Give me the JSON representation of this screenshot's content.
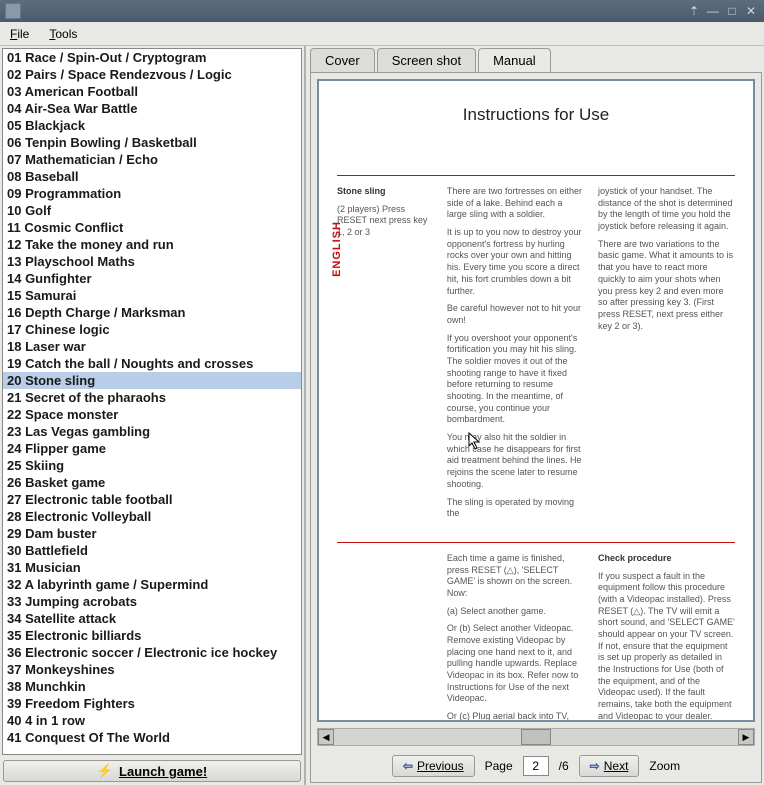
{
  "menu": {
    "file": "File",
    "tools": "Tools"
  },
  "titlebar": {
    "pin": "⇡",
    "min": "—",
    "max": "□",
    "close": "✕"
  },
  "games": {
    "selected_index": 19,
    "items": [
      "01 Race / Spin-Out / Cryptogram",
      "02 Pairs / Space Rendezvous / Logic",
      "03 American Football",
      "04 Air-Sea War Battle",
      "05 Blackjack",
      "06 Tenpin Bowling / Basketball",
      "07 Mathematician / Echo",
      "08 Baseball",
      "09 Programmation",
      "10 Golf",
      "11 Cosmic Conflict",
      "12 Take the money and run",
      "13 Playschool Maths",
      "14 Gunfighter",
      "15 Samurai",
      "16 Depth Charge / Marksman",
      "17 Chinese logic",
      "18 Laser war",
      "19 Catch the ball / Noughts and crosses",
      "20 Stone sling",
      "21 Secret of the pharaohs",
      "22 Space monster",
      "23 Las Vegas gambling",
      "24 Flipper game",
      "25 Skiing",
      "26 Basket game",
      "27 Electronic table football",
      "28 Electronic Volleyball",
      "29 Dam buster",
      "30 Battlefield",
      "31 Musician",
      "32 A labyrinth game / Supermind",
      "33 Jumping acrobats",
      "34 Satellite attack",
      "35 Electronic billiards",
      "36 Electronic soccer / Electronic ice hockey",
      "37 Monkeyshines",
      "38 Munchkin",
      "39 Freedom Fighters",
      "40 4 in 1 row",
      "41 Conquest Of The World"
    ]
  },
  "launch_label": "Launch game!",
  "tabs": {
    "cover": "Cover",
    "screenshot": "Screen shot",
    "manual": "Manual",
    "active": "manual"
  },
  "manual": {
    "title": "Instructions for Use",
    "english": "ENGLISH",
    "col1_h": "Stone sling",
    "col1_sub": "(2 players) Press RESET next press key 1, 2 or 3",
    "col2_p1": "There are two fortresses on either side of a lake. Behind each a large sling with a soldier.",
    "col2_p2": "It is up to you now to destroy your opponent's fortress by hurling rocks over your own and hitting his. Every time you score a direct hit, his fort crumbles down a bit further.",
    "col2_p3": "Be careful however not to hit your own!",
    "col2_p4": "If you overshoot your opponent's fortification you may hit his sling. The soldier moves it out of the shooting range to have it fixed before returning to resume shooting. In the meantime, of course, you continue your bombardment.",
    "col2_p5": "You may also hit the soldier in which case he disappears for first aid treatment behind the lines. He rejoins the scene later to resume shooting.",
    "col2_p6": "The sling is operated by moving the",
    "col3_p1": "joystick of your handset. The distance of the shot is determined by the length of time you hold the joystick before releasing it again.",
    "col3_p2": "There are two variations to the basic game. What it amounts to is that you have to react more quickly to aim your shots when you press key 2 and even more so after pressing key 3. (First press RESET, next press either key 2 or 3).",
    "b_col2_p1": "Each time a game is finished, press RESET (△), 'SELECT GAME' is shown on the screen. Now:",
    "b_col2_a": "(a) Select another game.",
    "b_col2_b": "Or (b) Select another Videopac. Remove existing Videopac by placing one hand next to it, and pulling handle upwards. Replace Videopac in its box. Refer now to Instructions for Use of the next Videopac.",
    "b_col2_c": "Or (c) Plug aerial back into TV, and unplug the Videopac Computer from the mains.",
    "b_col3_h": "Check procedure",
    "b_col3_p": "If you suspect a fault in the equipment follow this procedure (with a Videopac installed). Press RESET (△). The TV will emit a short sound, and 'SELECT GAME' should appear on your TV screen. If not, ensure that the equipment is set up properly as detailed in the Instructions for Use (both of the equipment, and of the Videopac used). If the fault remains, take both the equipment and Videopac to your dealer."
  },
  "pager": {
    "prev": "Previous",
    "next": "Next",
    "page_label": "Page",
    "page_value": "2",
    "page_total": "/6",
    "zoom": "Zoom"
  }
}
